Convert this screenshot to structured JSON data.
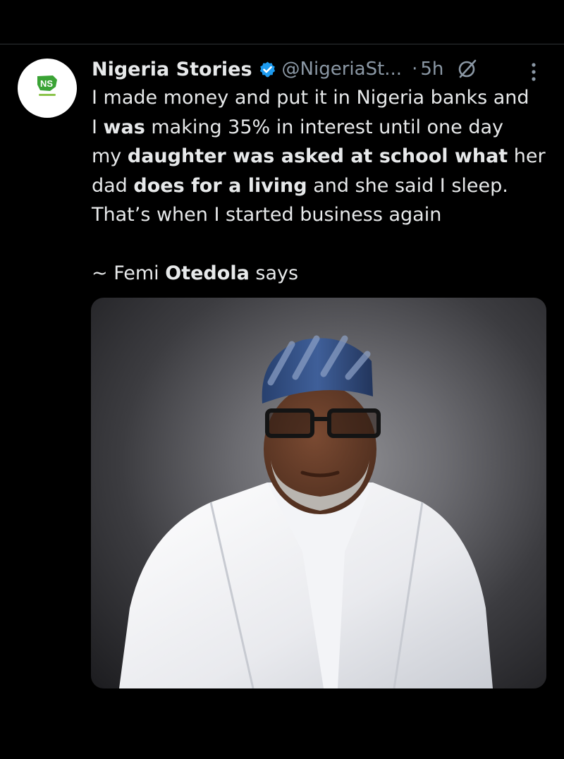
{
  "tweet": {
    "author_name": "Nigeria Stories",
    "handle": "@NigeriaSt...",
    "separator": "·",
    "time": "5h",
    "avatar_text": "NS",
    "body": {
      "line1": "I made money and put it in Nigeria banks and",
      "line2": {
        "a": "I ",
        "b": "was",
        "c": " making  35% in interest until one day"
      },
      "line3": {
        "a": "my ",
        "b": "daughter was asked at school what",
        "c": " her"
      },
      "line4": {
        "a": "dad ",
        "b": "does for a living",
        "c": " and she said I sleep."
      },
      "line5": "That’s when I started business again"
    },
    "quote": {
      "prefix": "~ Femi ",
      "bold": "Otedola",
      "suffix": " says"
    }
  },
  "icons": {
    "verified": "verified-badge-icon",
    "grok": "grok-icon",
    "more": "more-vertical-icon"
  },
  "colors": {
    "background": "#000000",
    "text": "#e7e9ea",
    "secondary": "#8b98a5",
    "verified": "#1d9bf0",
    "logo_green": "#3aa335"
  }
}
